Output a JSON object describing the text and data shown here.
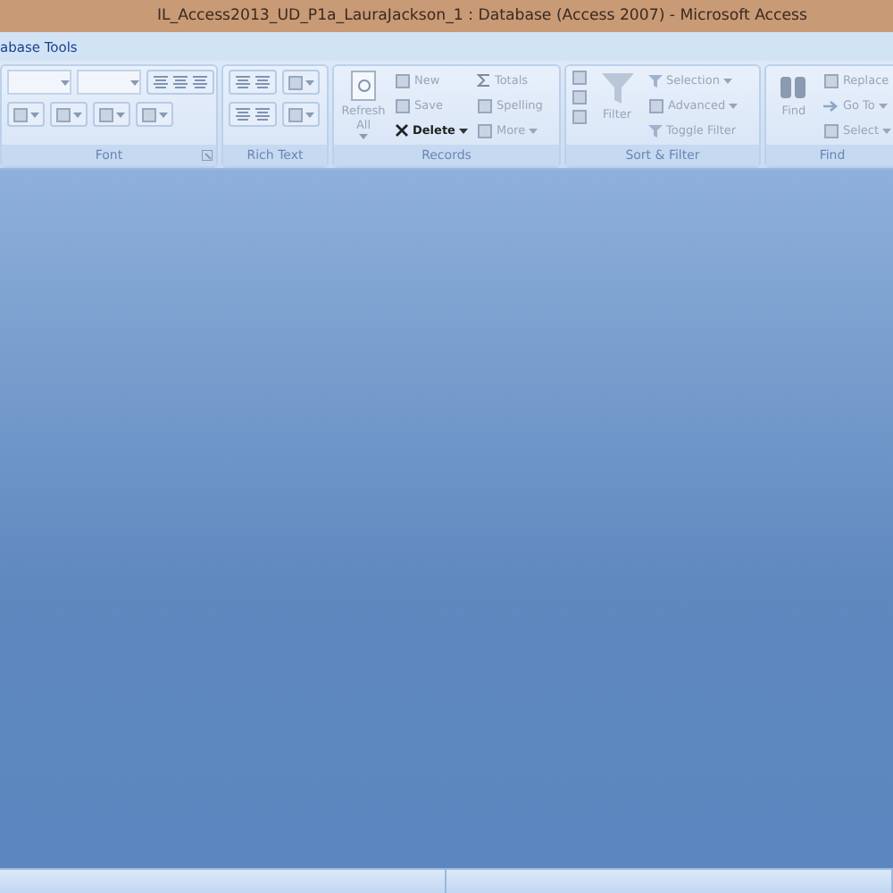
{
  "window": {
    "title": "IL_Access2013_UD_P1a_LauraJackson_1 : Database (Access 2007) - Microsoft Access"
  },
  "tabs": [
    {
      "label": "abase Tools",
      "selected": false
    }
  ],
  "groups": [
    {
      "label": "Font",
      "kind": "font",
      "launcher": true
    },
    {
      "label": "Rich Text",
      "kind": "richtext",
      "launcher": false
    },
    {
      "label": "Records",
      "kind": "commands",
      "launcher": false,
      "large": [
        {
          "label": "Refresh All",
          "dropdown": true,
          "disabled": true
        }
      ],
      "small": [
        {
          "label": "New",
          "dropdown": false,
          "disabled": true
        },
        {
          "label": "Save",
          "dropdown": false,
          "disabled": true
        },
        {
          "label": "Delete",
          "dropdown": true,
          "disabled": false
        },
        {
          "label": "Totals",
          "dropdown": false,
          "disabled": true
        },
        {
          "label": "Spelling",
          "dropdown": false,
          "disabled": true
        },
        {
          "label": "More",
          "dropdown": true,
          "disabled": true
        }
      ]
    },
    {
      "label": "Sort & Filter",
      "kind": "sort",
      "launcher": false,
      "large": [
        {
          "label": "Filter",
          "dropdown": false,
          "disabled": true
        }
      ],
      "small": [
        {
          "label": "Selection",
          "dropdown": true,
          "disabled": true
        },
        {
          "label": "Advanced",
          "dropdown": true,
          "disabled": true
        },
        {
          "label": "Toggle Filter",
          "dropdown": false,
          "disabled": true
        }
      ]
    },
    {
      "label": "Find",
      "kind": "commands",
      "launcher": false,
      "large": [
        {
          "label": "Find",
          "dropdown": false,
          "disabled": true
        }
      ],
      "small": [
        {
          "label": "Replace",
          "dropdown": false,
          "disabled": true
        },
        {
          "label": "Go To",
          "dropdown": true,
          "disabled": true
        },
        {
          "label": "Select",
          "dropdown": true,
          "disabled": true
        }
      ]
    }
  ]
}
